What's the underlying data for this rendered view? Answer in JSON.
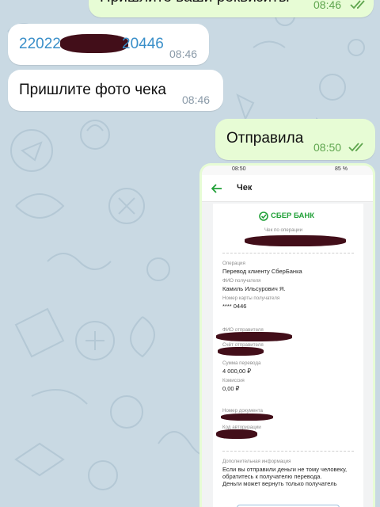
{
  "chat": {
    "top_message": {
      "text": "Пришлите ваши реквизиты",
      "time": "08:46"
    },
    "card_message": {
      "text_start": "22022",
      "text_end": "20446",
      "time": "08:46"
    },
    "photo_request": {
      "text": "Пришлите фото чека",
      "time": "08:46"
    },
    "sent_message": {
      "text": "Отправила",
      "time": "08:50"
    }
  },
  "receipt_photo": {
    "status_time": "08:50",
    "status_right": "85 %",
    "screen_title": "Чек",
    "bank_name": "СБЕР БАНК",
    "subtitle": "Чек по операции",
    "operation_label": "Операция",
    "operation_value": "Перевод клиенту СберБанка",
    "recipient_label": "ФИО получателя",
    "recipient_value": "Камиль Ильсурович Я.",
    "recipient_card_label": "Номер карты получателя",
    "recipient_card_value": "**** 0446",
    "sender_label": "ФИО отправителя",
    "sender_account_label": "Счёт отправителя",
    "amount_label": "Сумма перевода",
    "amount_value": "4 000,00 ₽",
    "fee_label": "Комиссия",
    "fee_value": "0,00 ₽",
    "doc_number_label": "Номер документа",
    "auth_code_label": "Код авторизации",
    "extra_label": "Дополнительная информация",
    "extra_line1": "Если вы отправили деньги не тому человеку,",
    "extra_line2": "обратитесь к получателю перевода.",
    "extra_line3": "Деньги может вернуть только получатель"
  },
  "colors": {
    "wallpaper": "#c9d9e3",
    "incoming_bubble": "#ffffff",
    "outgoing_bubble": "#e7fcd5",
    "outgoing_time": "#5ea54e",
    "sber_green": "#21a038",
    "redaction": "#3a0410"
  }
}
